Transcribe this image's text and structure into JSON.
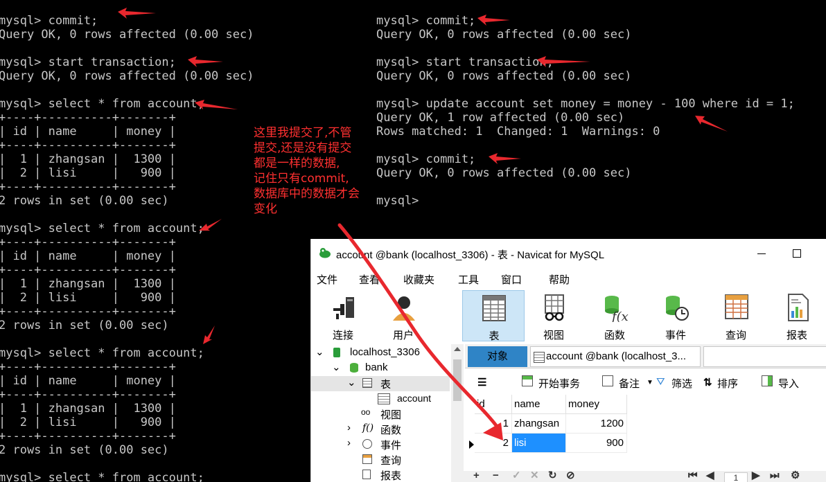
{
  "left_terminal": {
    "text": "mysql> commit;\nQuery OK, 0 rows affected (0.00 sec)\n\nmysql> start transaction;\nQuery OK, 0 rows affected (0.00 sec)\n\nmysql> select * from account;\n+----+----------+-------+\n| id | name     | money |\n+----+----------+-------+\n|  1 | zhangsan |  1300 |\n|  2 | lisi     |   900 |\n+----+----------+-------+\n2 rows in set (0.00 sec)\n\nmysql> select * from account;\n+----+----------+-------+\n| id | name     | money |\n+----+----------+-------+\n|  1 | zhangsan |  1300 |\n|  2 | lisi     |   900 |\n+----+----------+-------+\n2 rows in set (0.00 sec)\n\nmysql> select * from account;\n+----+----------+-------+\n| id | name     | money |\n+----+----------+-------+\n|  1 | zhangsan |  1300 |\n|  2 | lisi     |   900 |\n+----+----------+-------+\n2 rows in set (0.00 sec)\n\nmysql> select * from account;"
  },
  "right_terminal": {
    "text": "mysql> commit;\nQuery OK, 0 rows affected (0.00 sec)\n\nmysql> start transaction;\nQuery OK, 0 rows affected (0.00 sec)\n\nmysql> update account set money = money - 100 where id = 1;\nQuery OK, 1 row affected (0.00 sec)\nRows matched: 1  Changed: 1  Warnings: 0\n\nmysql> commit;\nQuery OK, 0 rows affected (0.00 sec)\n\nmysql>"
  },
  "annotation": {
    "lines": [
      "这里我提交了,不管",
      "提交,还是没有提交",
      "都是一样的数据,",
      "记住只有commit,",
      "数据库中的数据才会",
      "变化"
    ]
  },
  "navicat": {
    "title": "account @bank (localhost_3306) - 表 - Navicat for MySQL",
    "menu": [
      "文件",
      "查看",
      "收藏夹",
      "工具",
      "窗口",
      "帮助"
    ],
    "toolbar": [
      "连接",
      "用户",
      "表",
      "视图",
      "函数",
      "事件",
      "查询",
      "报表"
    ],
    "tree": {
      "connection": "localhost_3306",
      "database": "bank",
      "tables_group": "表",
      "table": "account",
      "views": "视图",
      "functions": "函数",
      "events": "事件",
      "queries": "查询",
      "reports": "报表"
    },
    "tabs": {
      "objects": "对象",
      "table_tab": "account @bank (localhost_3..."
    },
    "data_toolbar": {
      "begin_tx": "开始事务",
      "memo": "备注",
      "filter": "筛选",
      "sort": "排序",
      "import": "导入"
    },
    "grid": {
      "columns": [
        "id",
        "name",
        "money"
      ],
      "rows": [
        {
          "id": "1",
          "name": "zhangsan",
          "money": "1200"
        },
        {
          "id": "2",
          "name": "lisi",
          "money": "900"
        }
      ]
    },
    "pager": "1"
  },
  "colors": {
    "annotation_red": "#ff3030",
    "terminal_text": "#c8c8c8",
    "selection_blue": "#1e90ff",
    "active_tab": "#2f84c6"
  }
}
